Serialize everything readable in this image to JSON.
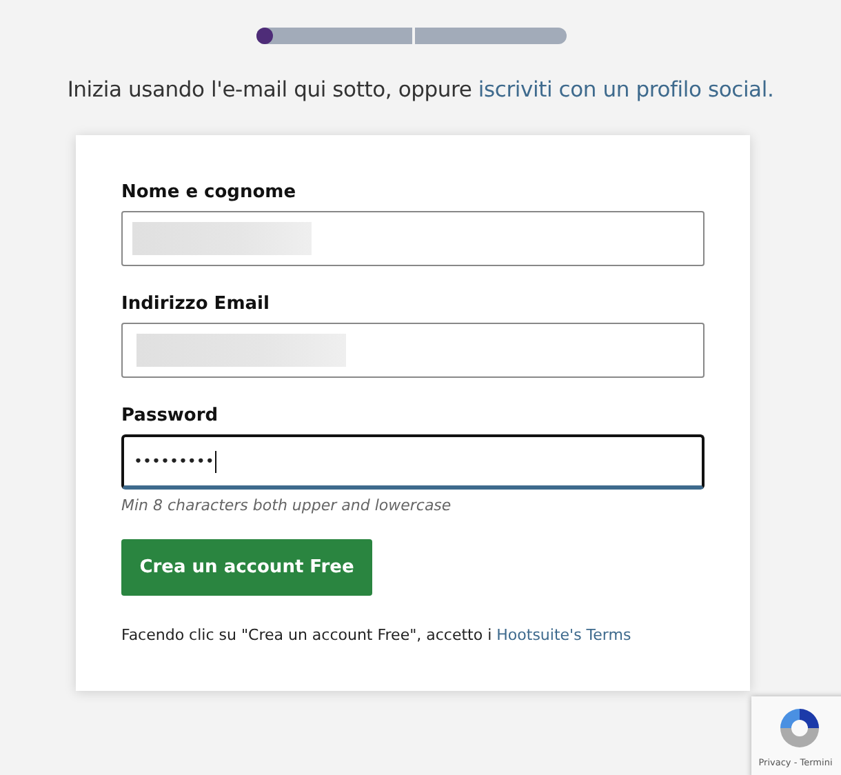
{
  "progress": {
    "level": 0
  },
  "intro": {
    "text": "Inizia usando l'e-mail qui sotto, oppure ",
    "link": "iscriviti con un profilo social."
  },
  "form": {
    "fields": [
      {
        "label": "Nome e cognome",
        "redacted": true,
        "focused": false
      },
      {
        "label": "Indirizzo Email",
        "redacted": true,
        "focused": false
      },
      {
        "label": "Password",
        "value": "•••••••••",
        "focused": true,
        "hint": "Min 8 characters both upper and lowercase"
      }
    ],
    "submit": "Crea un account Free",
    "terms": {
      "text": "Facendo clic su \"Crea un account Free\", accetto i ",
      "link": "Hootsuite's Terms"
    }
  },
  "recaptcha": {
    "links": "Privacy - Termini"
  }
}
